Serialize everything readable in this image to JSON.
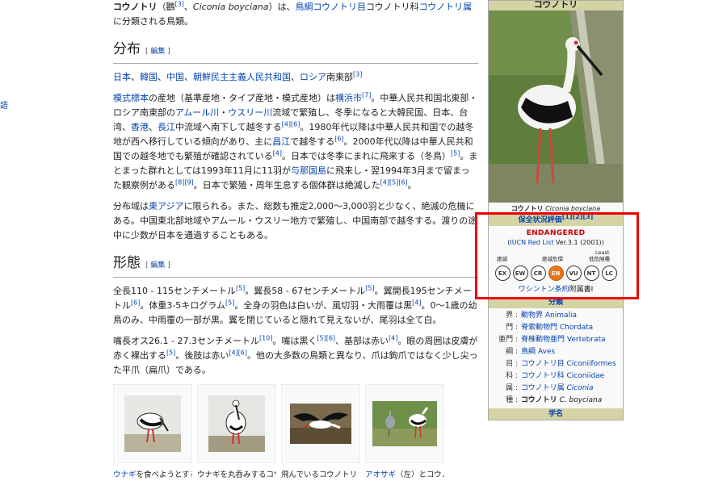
{
  "left_edge": {
    "glyph": "語"
  },
  "intro": {
    "text1": "コウノトリ",
    "text2": "（鸛",
    "ref1": "[3]",
    "text3": "、",
    "sci": "Ciconia boyciana",
    "text4": "）は、",
    "link1": "鳥綱コウノトリ目",
    "text5": "コウノトリ科",
    "link2": "コウノトリ属",
    "text6": "に分類される鳥類。"
  },
  "sections": [
    {
      "title": "分布",
      "edit": "編集"
    },
    {
      "title": "形態",
      "edit": "編集"
    }
  ],
  "distribution": {
    "countries": [
      "日本",
      "韓国",
      "中国",
      "朝鮮民主主義人民共和国",
      "ロシア"
    ],
    "sep": "、",
    "tail": "南東部",
    "ref": "[3]",
    "p2": {
      "a": "模式標本",
      "b": "の産地（基準産地・タイプ産地・模式産地）は",
      "c": "横浜市",
      "r1": "[7]",
      "d": "。中華人民共和国北東部・ロシア南東部の",
      "e": "アムール川",
      "f": "・",
      "g": "ウスリー川",
      "h": "流域で繁殖し、冬季になると大韓民国、日本、台湾、",
      "i": "香港",
      "j": "、",
      "k": "長江",
      "l": "中流域へ南下して越冬する",
      "r2": "[4][6]",
      "m": "。1980年代以降は中華人民共和国での越冬地が西へ移行している傾向があり、主に",
      "n": "昌江",
      "o": "で越冬する",
      "r3": "[6]",
      "p": "。2000年代以降は中華人民共和国での越冬地でも繁殖が確認されている",
      "r4": "[4]",
      "q": "。日本では冬季にまれに飛来する（冬鳥）",
      "r5": "[5]",
      "s": "。まとまった群れとしては1993年11月に11羽が",
      "t": "与那国島",
      "u": "に飛来し・翌1994年3月まで留まった観察例がある",
      "r6": "[8][9]",
      "v": "。日本で繁殖・周年生息する個体群は絶滅した",
      "r7": "[4][5][6]",
      "w": "。"
    },
    "p3": {
      "a": "分布域は",
      "b": "東アジア",
      "c": "に限られる。また、総数も推定2,000～3,000羽と少なく、絶滅の危機にある。中国東北部地域やアムール・ウスリー地方で繁殖し、中国南部で越冬する。渡りの途中に少数が日本を通過することもある。"
    }
  },
  "morphology": {
    "p1": {
      "a": "全長110 - 115センチメートル",
      "r1": "[5]",
      "b": "。翼長58 - 67センチメートル",
      "r2": "[5]",
      "c": "。翼開長195センチメートル",
      "r3": "[6]",
      "d": "。体重3-5キログラム",
      "r4": "[5]",
      "e": "。全身の羽色は白いが、風切羽・大雨覆は黒",
      "r5": "[4]",
      "f": "。0～1歳の幼鳥のみ、中雨覆の一部が黒。翼を閉じていると隠れて見えないが、尾羽は全て白。"
    },
    "p2": {
      "a": "嘴長オス26.1 - 27.3センチメートル",
      "r1": "[10]",
      "b": "。嘴は黒く",
      "r2": "[5][6]",
      "c": "、基部は赤い",
      "r3": "[4]",
      "d": "。眼の周囲は皮膚が赤く裸出する",
      "r4": "[5]",
      "e": "。後肢は赤い",
      "r5": "[4][6]",
      "f": "。他の大多数の鳥類と異なり、爪は鉤爪ではなく少し尖った平爪（扁爪）である。"
    }
  },
  "gallery": [
    {
      "link": "ウナギ",
      "text": "を食べようとする"
    },
    {
      "link": "",
      "text": "ウナギを丸呑みするコウ"
    },
    {
      "link": "",
      "text": "飛んでいるコウノトリ"
    },
    {
      "link": "アオサギ",
      "text": "（左）とコウノ"
    }
  ],
  "infobox": {
    "title": "コウノトリ",
    "caption_jp": "コウノトリ",
    "caption_sci": "Ciconia boyciana",
    "status_head": "保全状況評価",
    "status_refs": "[1][2][3]",
    "status": "ENDANGERED",
    "iucn_open": "(",
    "iucn_link": "IUCN Red List",
    "iucn_ver": " Ver.3.1 (2001))",
    "scale_left": "絶滅",
    "scale_mid": "絶滅危惧",
    "scale_right_top": "Least",
    "scale_right": "低危険種",
    "categories": [
      "EX",
      "EW",
      "CR",
      "EN",
      "VU",
      "NT",
      "LC"
    ],
    "active_category": "EN",
    "cites_link": "ワシントン条約",
    "cites_text": "附属書I",
    "taxo_head": "分類",
    "taxonomy": [
      {
        "rank": "界",
        "name": "動物界",
        "latin": "Animalia",
        "italic": false
      },
      {
        "rank": "門",
        "name": "脊索動物門",
        "latin": "Chordata",
        "italic": false
      },
      {
        "rank": "亜門",
        "name": "脊椎動物亜門",
        "latin": "Vertebrata",
        "italic": false
      },
      {
        "rank": "綱",
        "name": "鳥綱",
        "latin": "Aves",
        "italic": false
      },
      {
        "rank": "目",
        "name": "コウノトリ目",
        "latin": "Ciconiiformes",
        "italic": false
      },
      {
        "rank": "科",
        "name": "コウノトリ科",
        "latin": "Ciconiidae",
        "italic": false
      },
      {
        "rank": "属",
        "name": "コウノトリ属",
        "latin": "Ciconia",
        "italic": true
      },
      {
        "rank": "種",
        "name": "コウノトリ",
        "latin": "C. boyciana",
        "italic": true,
        "bold": true
      }
    ],
    "gakumei_head": "学名"
  },
  "colors": {
    "highlight_box": "#ee0000",
    "endangered": "#cc0000",
    "active_status": "#e8751a",
    "infobox_head": "#d3d3a4"
  }
}
